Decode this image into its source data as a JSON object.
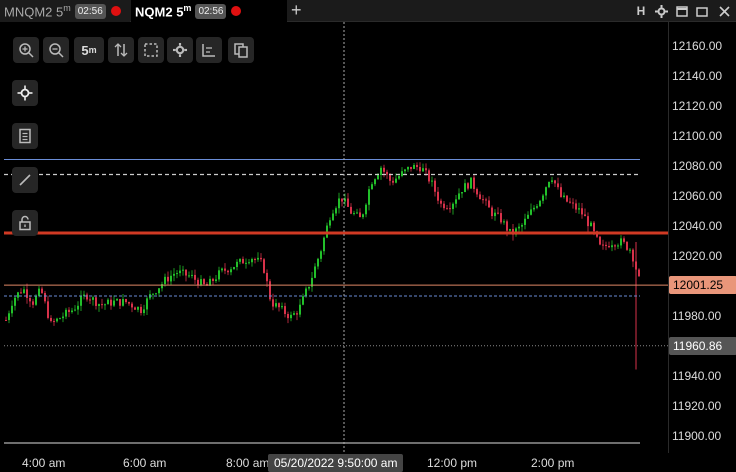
{
  "tabs": [
    {
      "symbol": "MNQM2",
      "interval": "5",
      "interval_unit": "m",
      "timer": "02:56",
      "active": false
    },
    {
      "symbol": "NQM2",
      "interval": "5",
      "interval_unit": "m",
      "timer": "02:56",
      "active": true
    }
  ],
  "window_controls": [
    "H",
    "gear-icon",
    "window-icon",
    "close-icon"
  ],
  "toolbar": {
    "buttons": [
      "zoom-in-icon",
      "zoom-out-icon",
      "interval",
      "crosshair-move-icon",
      "selection-icon",
      "gear-icon",
      "axis-icon",
      "copy-icon"
    ],
    "interval_label": "5",
    "interval_unit": "m"
  },
  "side_tools": [
    "crosshair-icon",
    "notes-icon",
    "line-draw-icon",
    "lock-icon"
  ],
  "y_axis": {
    "labels": [
      "12160.00",
      "12140.00",
      "12120.00",
      "12100.00",
      "12080.00",
      "12060.00",
      "12040.00",
      "12020.00",
      "11980.00",
      "11960.86",
      "11940.00",
      "11920.00",
      "11900.00"
    ]
  },
  "price_tags": {
    "current": "12001.25",
    "low": "11960.86"
  },
  "x_axis": {
    "labels": [
      "4:00 am",
      "6:00 am",
      "8:00 am",
      "12:00 pm",
      "2:00 pm"
    ],
    "crosshair_date": "05/20/2022 9:50:00 am"
  },
  "colors": {
    "up": "#22c02a",
    "down": "#d8324a",
    "red_level": "#d03a24",
    "orange_level": "#e08866",
    "blue_level": "#6a8dd6"
  },
  "chart_data": {
    "type": "candlestick",
    "y_range": [
      11890,
      12170
    ],
    "levels": [
      {
        "price": 12085,
        "style": "solid-blue"
      },
      {
        "price": 12075,
        "style": "dashed-white"
      },
      {
        "price": 12036,
        "style": "solid-red"
      },
      {
        "price": 12001.25,
        "style": "solid-orange"
      },
      {
        "price": 11994,
        "style": "dashed-blue"
      },
      {
        "price": 11960.86,
        "style": "dotted-gray"
      },
      {
        "price": 11896,
        "style": "solid-white"
      }
    ]
  }
}
